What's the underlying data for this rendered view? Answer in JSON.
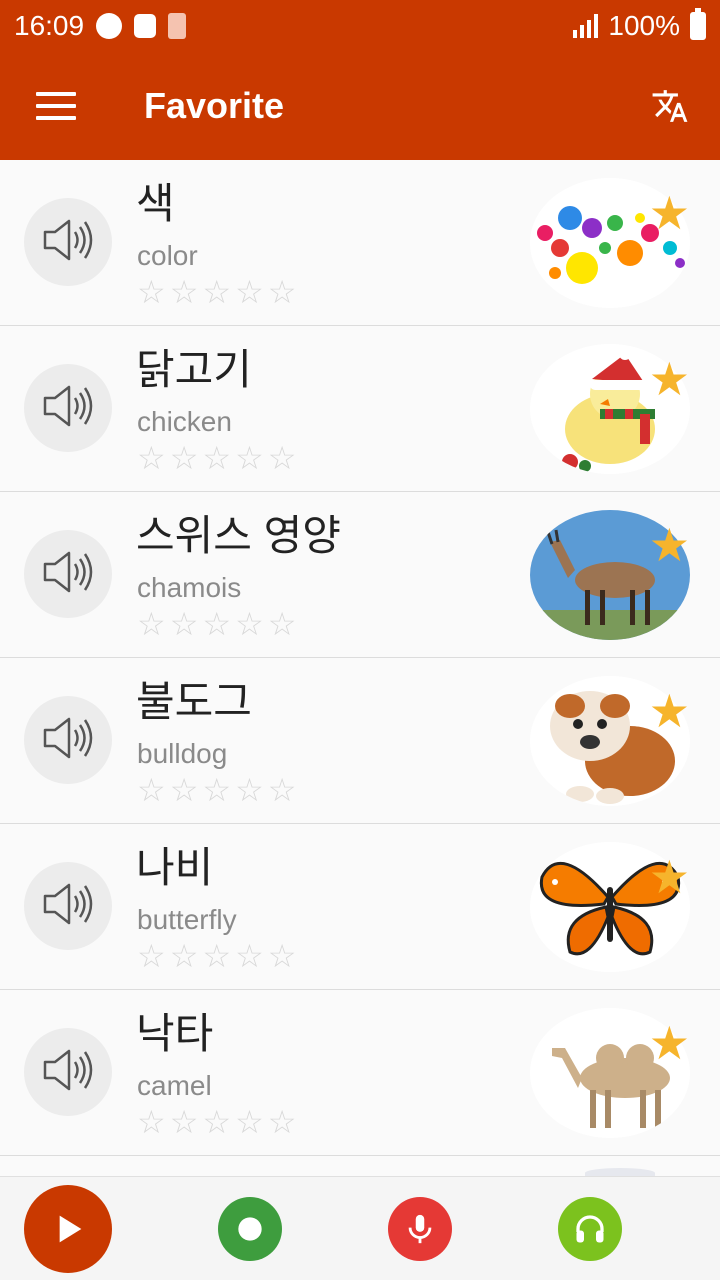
{
  "status_bar": {
    "time": "16:09",
    "battery_level": "100%"
  },
  "app_bar": {
    "title": "Favorite",
    "menu_icon": "hamburger-menu-icon",
    "translate_icon": "translate-icon"
  },
  "items": [
    {
      "word": "색",
      "translation": "color",
      "rating": 0,
      "favorite": true,
      "image": "colorful-bubbles"
    },
    {
      "word": "닭고기",
      "translation": "chicken",
      "rating": 0,
      "favorite": true,
      "image": "chick-with-santa-hat"
    },
    {
      "word": "스위스 영양",
      "translation": "chamois",
      "rating": 0,
      "favorite": true,
      "image": "chamois"
    },
    {
      "word": "불도그",
      "translation": "bulldog",
      "rating": 0,
      "favorite": true,
      "image": "bulldog-puppy"
    },
    {
      "word": "나비",
      "translation": "butterfly",
      "rating": 0,
      "favorite": true,
      "image": "orange-butterfly"
    },
    {
      "word": "낙타",
      "translation": "camel",
      "rating": 0,
      "favorite": true,
      "image": "camel"
    }
  ],
  "bottom_bar": {
    "play_icon": "play-icon",
    "record_icon": "record-icon",
    "mic_icon": "microphone-icon",
    "listen_icon": "headphones-icon"
  },
  "colors": {
    "primary": "#c93900",
    "star": "#f6b42c",
    "record": "#3e9d3e",
    "mic": "#e53935",
    "listen": "#7cc21e"
  }
}
